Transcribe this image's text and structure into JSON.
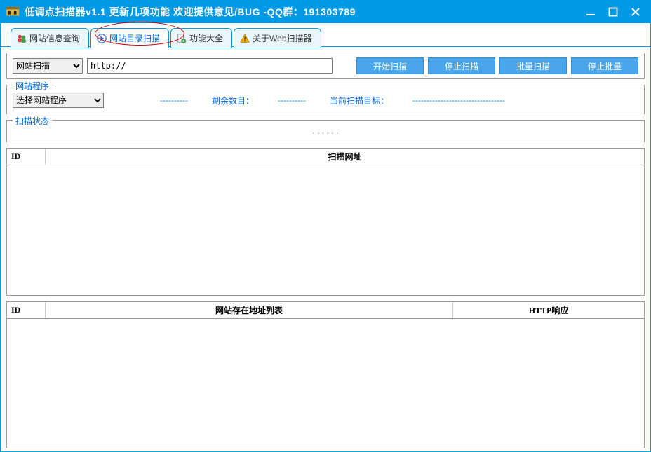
{
  "window": {
    "title": "低调点扫描器v1.1 更新几项功能 欢迎提供意见/BUG  -QQ群：191303789"
  },
  "tabs": [
    {
      "label": "网站信息查询"
    },
    {
      "label": "网站目录扫描",
      "active": true
    },
    {
      "label": "功能大全"
    },
    {
      "label": "关于Web扫描器"
    }
  ],
  "scan_bar": {
    "scan_type_label": "网站扫描",
    "url_value": "http://",
    "start_btn": "开始扫描",
    "stop_btn": "停止扫描",
    "batch_btn": "批量扫描",
    "stop_batch_btn": "停止批量"
  },
  "program_group": {
    "legend": "网站程序",
    "select_label": "选择网站程序",
    "dashes": "----------",
    "remaining_label": "剩余数目：",
    "remaining_value": "----------",
    "current_target_label": "当前扫描目标：",
    "current_target_value": "---------------------------------"
  },
  "status_group": {
    "legend": "扫描状态",
    "body": ". . .  . . ."
  },
  "table1": {
    "col_id": "ID",
    "col_url": "扫描网址"
  },
  "table2": {
    "col_id": "ID",
    "col_addr": "网站存在地址列表",
    "col_http": "HTTP响应"
  }
}
